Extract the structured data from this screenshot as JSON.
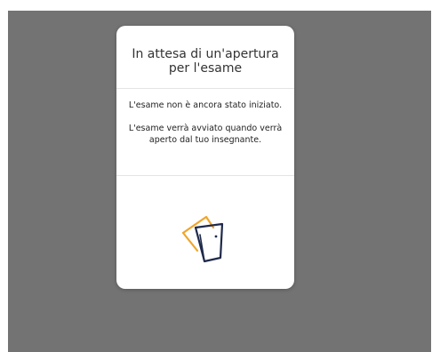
{
  "modal": {
    "title": "In attesa di un'apertura per l'esame",
    "message_not_started": "L'esame non è ancora stato iniziato.",
    "message_wait": "L'esame verrà avviato quando verrà aperto dal tuo insegnante.",
    "illustration_icon": "open-door-icon"
  },
  "colors": {
    "backdrop": "#737373",
    "door_outline": "#1f2a4a",
    "door_accent": "#f0a52a"
  }
}
